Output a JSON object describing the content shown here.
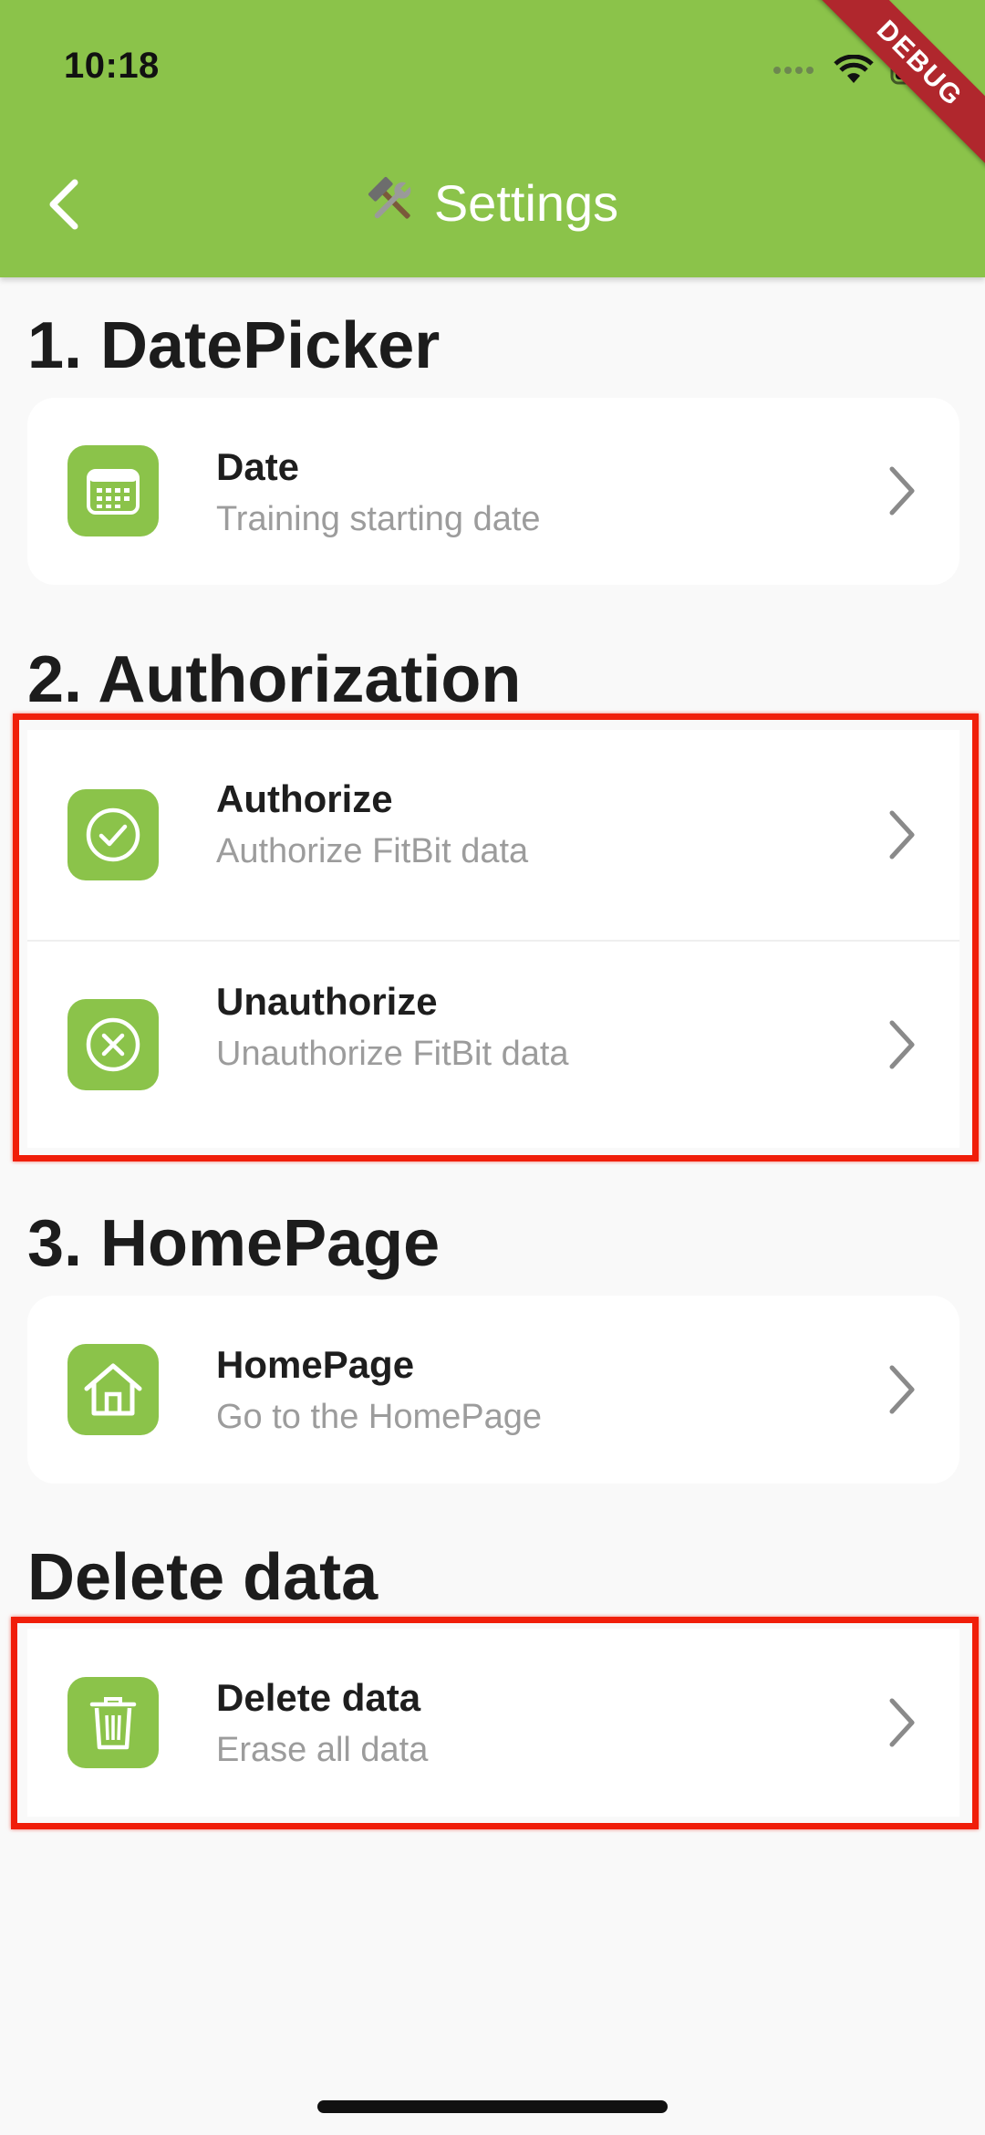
{
  "status_bar": {
    "time": "10:18"
  },
  "app_bar": {
    "title_emoji": "🛠️",
    "title": "Settings",
    "back_icon": "chevron-left-icon",
    "debug_label": "DEBUG"
  },
  "sections": [
    {
      "heading": "1. DatePicker",
      "items": [
        {
          "title": "Date",
          "subtitle": "Training starting date",
          "icon": "calendar-icon"
        }
      ]
    },
    {
      "heading": "2. Authorization",
      "items": [
        {
          "title": "Authorize",
          "subtitle": "Authorize FitBit data",
          "icon": "check-circle-icon"
        },
        {
          "title": "Unauthorize",
          "subtitle": "Unauthorize FitBit data",
          "icon": "cancel-circle-icon"
        }
      ]
    },
    {
      "heading": "3. HomePage",
      "items": [
        {
          "title": "HomePage",
          "subtitle": "Go to the HomePage",
          "icon": "home-icon"
        }
      ]
    },
    {
      "heading": "Delete data",
      "items": [
        {
          "title": "Delete data",
          "subtitle": "Erase all data",
          "icon": "trash-icon"
        }
      ]
    }
  ],
  "colors": {
    "accent": "#8bc34a",
    "highlight": "#f01e0a",
    "debug_banner": "#b0272d"
  }
}
